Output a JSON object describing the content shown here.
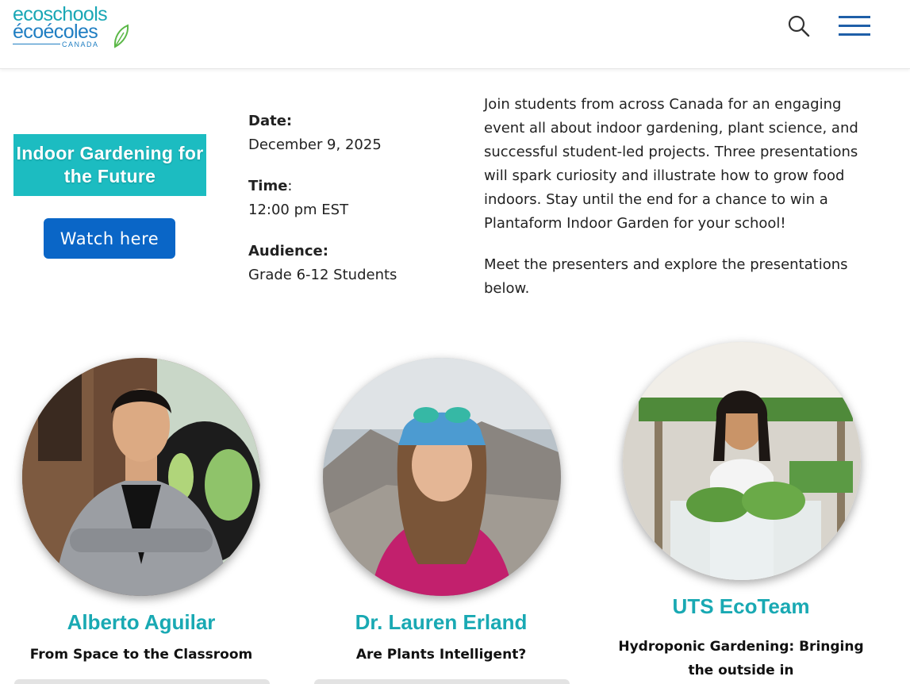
{
  "header": {
    "logo": {
      "line1": "ecoschools",
      "line2": "écoécoles",
      "line3": "CANADA"
    },
    "search_icon": "search-icon",
    "menu_icon": "hamburger-menu-icon",
    "brand_colors": {
      "teal": "#1cbcc1",
      "blue": "#1f7ec2"
    }
  },
  "event": {
    "badge_title": "Indoor Gardening for the Future",
    "watch_label": "Watch here",
    "date_label": "Date:",
    "date_value": "December 9, 2025",
    "time_label": "Time",
    "time_colon": ":",
    "time_value": "12:00 pm EST",
    "audience_label": "Audience:",
    "audience_value": "Grade 6-12 Students",
    "description": " Join students from across Canada for an engaging event all about indoor gardening, plant science, and successful student-led projects. Three presentations will spark curiosity and illustrate how to grow food indoors. Stay until the end for a chance to win a Plantaform Indoor Garden for your school!",
    "meet_text": "Meet the presenters and explore the presentations below."
  },
  "presenters": [
    {
      "name": "Alberto Aguilar",
      "talk": "From Space to the Classroom"
    },
    {
      "name": "Dr. Lauren Erland",
      "talk": "Are Plants Intelligent?"
    },
    {
      "name": "UTS EcoTeam",
      "talk": "Hydroponic Gardening: Bringing the outside in"
    }
  ]
}
